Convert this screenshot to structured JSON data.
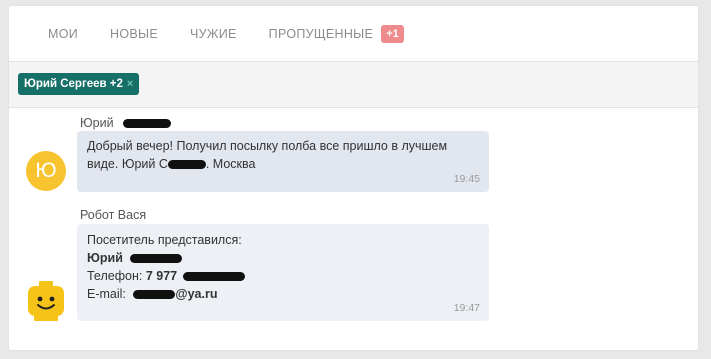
{
  "tabs": [
    {
      "label": "МОИ"
    },
    {
      "label": "НОВЫЕ"
    },
    {
      "label": "ЧУЖИЕ"
    },
    {
      "label": "ПРОПУЩЕННЫЕ",
      "badge": "+1"
    }
  ],
  "filter_chip": {
    "label": "Юрий Сергеев +2",
    "remove_icon": "×"
  },
  "messages": [
    {
      "sender": "Юрий",
      "avatar_letter": "Ю",
      "line1": "Добрый вечер! Получил посылку полба все пришло в лучшем",
      "line2_prefix": "виде. Юрий С",
      "line2_suffix": ". Москва",
      "time": "19:45"
    },
    {
      "sender": "Робот Вася",
      "intro": "Посетитель представился:",
      "name": "Юрий",
      "phone_label": "Телефон:",
      "phone_value": "7 977",
      "email_label": "E-mail:",
      "email_value": "@ya.ru",
      "time": "19:47"
    }
  ],
  "colors": {
    "accent": "#177068",
    "badge": "#f08b8d",
    "avatar_yellow": "#f7c32e",
    "bubble_incoming": "#e2e6ee",
    "bubble_bot": "#edf0f5"
  }
}
